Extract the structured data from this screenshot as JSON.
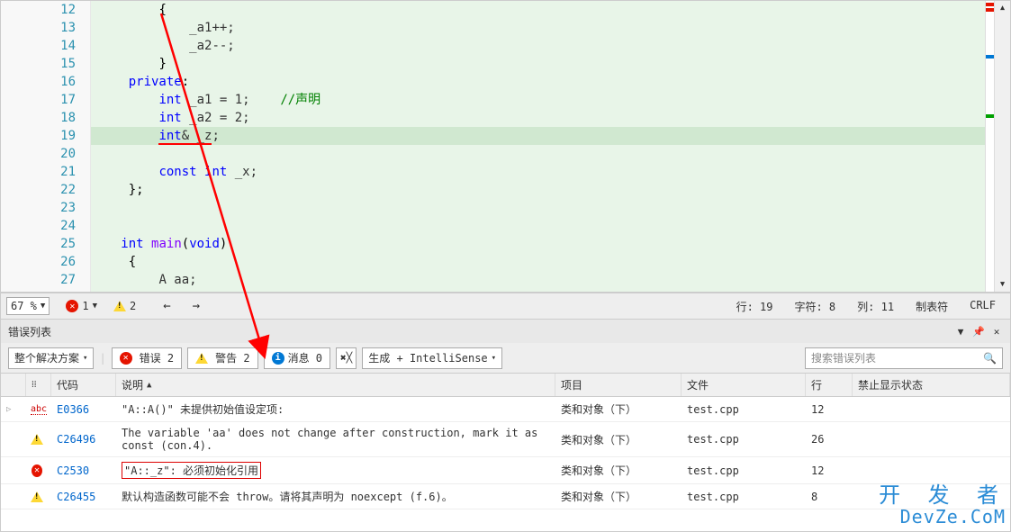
{
  "code": {
    "start": 12,
    "lines": [
      {
        "n": 12,
        "indent": "        ",
        "tokens": [
          {
            "t": "{",
            "c": "br"
          }
        ]
      },
      {
        "n": 13,
        "indent": "            ",
        "tokens": [
          {
            "t": "_a1++;",
            "c": ""
          }
        ]
      },
      {
        "n": 14,
        "indent": "            ",
        "tokens": [
          {
            "t": "_a2--;",
            "c": ""
          }
        ]
      },
      {
        "n": 15,
        "indent": "        ",
        "tokens": [
          {
            "t": "}",
            "c": "br"
          }
        ]
      },
      {
        "n": 16,
        "indent": "    ",
        "tokens": [
          {
            "t": "private",
            "c": "kw"
          },
          {
            "t": ":",
            "c": "br"
          }
        ]
      },
      {
        "n": 17,
        "indent": "        ",
        "tokens": [
          {
            "t": "int",
            "c": "kw"
          },
          {
            "t": " _a1 = 1;    ",
            "c": ""
          },
          {
            "t": "//声明",
            "c": "cmt"
          }
        ]
      },
      {
        "n": 18,
        "indent": "        ",
        "tokens": [
          {
            "t": "int",
            "c": "kw"
          },
          {
            "t": " _a2 = 2;",
            "c": ""
          }
        ]
      },
      {
        "n": 19,
        "indent": "        ",
        "tokens": [
          {
            "t": "int",
            "c": "kw",
            "u": true
          },
          {
            "t": "& _z",
            "c": "",
            "u": true
          },
          {
            "t": ";",
            "c": ""
          }
        ],
        "hl": true
      },
      {
        "n": 20,
        "indent": "",
        "tokens": []
      },
      {
        "n": 21,
        "indent": "        ",
        "tokens": [
          {
            "t": "const",
            "c": "kw"
          },
          {
            "t": " ",
            "c": ""
          },
          {
            "t": "int",
            "c": "kw"
          },
          {
            "t": " _x;",
            "c": ""
          }
        ]
      },
      {
        "n": 22,
        "indent": "    ",
        "tokens": [
          {
            "t": "};",
            "c": "br"
          }
        ]
      },
      {
        "n": 23,
        "indent": "",
        "tokens": []
      },
      {
        "n": 24,
        "indent": "",
        "tokens": []
      },
      {
        "n": 25,
        "indent": "   ",
        "tokens": [
          {
            "t": "int",
            "c": "kw"
          },
          {
            "t": " ",
            "c": ""
          },
          {
            "t": "main",
            "c": "kw2"
          },
          {
            "t": "(",
            "c": "br"
          },
          {
            "t": "void",
            "c": "kw"
          },
          {
            "t": ")",
            "c": "br"
          }
        ]
      },
      {
        "n": 26,
        "indent": "    ",
        "tokens": [
          {
            "t": "{",
            "c": "br"
          }
        ]
      },
      {
        "n": 27,
        "indent": "        ",
        "tokens": [
          {
            "t": "A aa;",
            "c": ""
          }
        ]
      }
    ]
  },
  "status": {
    "zoom": "67 %",
    "errors": "1",
    "warnings": "2",
    "line_label": "行: 19",
    "char_label": "字符: 8",
    "col_label": "列: 11",
    "tabs_label": "制表符",
    "crlf": "CRLF"
  },
  "panel": {
    "title": "错误列表",
    "scope": "整个解决方案",
    "btn_errors": "错误 2",
    "btn_warnings": "警告 2",
    "btn_messages": "消息 0",
    "build_filter": "生成 + IntelliSense",
    "search_placeholder": "搜索错误列表"
  },
  "columns": {
    "code": "代码",
    "desc": "说明",
    "proj": "项目",
    "file": "文件",
    "line": "行",
    "sup": "禁止显示状态"
  },
  "rows": [
    {
      "icon": "abc",
      "code": "E0366",
      "desc": "\"A::A()\" 未提供初始值设定项:",
      "proj": "类和对象（下）",
      "file": "test.cpp",
      "line": "12",
      "expand": true
    },
    {
      "icon": "warn",
      "code": "C26496",
      "desc": "The variable 'aa' does not change after construction, mark it as const (con.4).",
      "proj": "类和对象（下）",
      "file": "test.cpp",
      "line": "26"
    },
    {
      "icon": "err",
      "code": "C2530",
      "desc": "\"A::_z\": 必须初始化引用",
      "proj": "类和对象（下）",
      "file": "test.cpp",
      "line": "12",
      "highlight": true
    },
    {
      "icon": "warn",
      "code": "C26455",
      "desc": "默认构造函数可能不会 throw。请将其声明为 noexcept (f.6)。",
      "proj": "类和对象（下）",
      "file": "test.cpp",
      "line": "8"
    }
  ],
  "watermark": {
    "cn": "开 发 者",
    "en": "DevZe.CoM"
  }
}
